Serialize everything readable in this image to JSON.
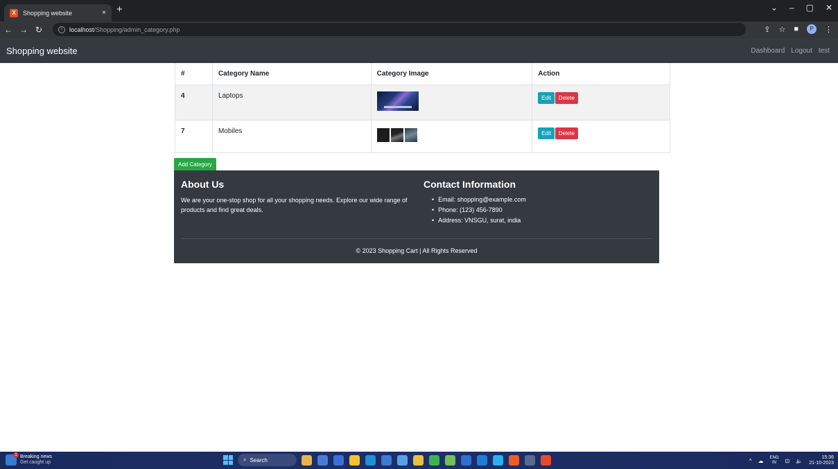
{
  "browser": {
    "tab_title": "Shopping website",
    "tab_close": "×",
    "new_tab": "+",
    "url_host": "localhost",
    "url_path": "/Shopping/admin_category.php",
    "window_controls": [
      "⌄",
      "–",
      "▢",
      "✕"
    ]
  },
  "navbar": {
    "brand": "Shopping website",
    "links": [
      "Dashboard",
      "Logout",
      "test"
    ]
  },
  "table": {
    "headers": [
      "#",
      "Category Name",
      "Category Image",
      "Action"
    ],
    "rows": [
      {
        "id": "4",
        "name": "Laptops",
        "image": "laptop-thumbnail",
        "edit": "Edit",
        "delete": "Delete"
      },
      {
        "id": "7",
        "name": "Mobiles",
        "image": "mobile-thumbnail",
        "edit": "Edit",
        "delete": "Delete"
      }
    ]
  },
  "add_category_label": "Add Category",
  "footer": {
    "about_title": "About Us",
    "about_text": "We are your one-stop shop for all your shopping needs. Explore our wide range of products and find great deals.",
    "contact_title": "Contact Information",
    "contact_items": [
      "Email: shopping@example.com",
      "Phone: (123) 456-7890",
      "Address: VNSGU, surat, india"
    ],
    "copyright": "© 2023 Shopping Cart | All Rights Reserved"
  },
  "taskbar": {
    "news_title": "Breaking news",
    "news_subtitle": "Get caught up",
    "search_label": "Search",
    "lang_top": "ENG",
    "lang_bottom": "IN",
    "time": "15:36",
    "date": "21-10-2023"
  },
  "colors": {
    "navbar_bg": "#343a40",
    "edit": "#17a2b8",
    "delete": "#dc3545",
    "add": "#28a745",
    "app_icons": [
      "#e8b34b",
      "#4a7bd8",
      "#3b6fd4",
      "#f2c230",
      "#1f8fd6",
      "#3a7bd5",
      "#5aa0e8",
      "#e8c040",
      "#3fb24f",
      "#6fbf5a",
      "#2f6fd0",
      "#1e7fd8",
      "#2bb0f0",
      "#f05a28",
      "#5a6a8a",
      "#e84b2a"
    ]
  }
}
